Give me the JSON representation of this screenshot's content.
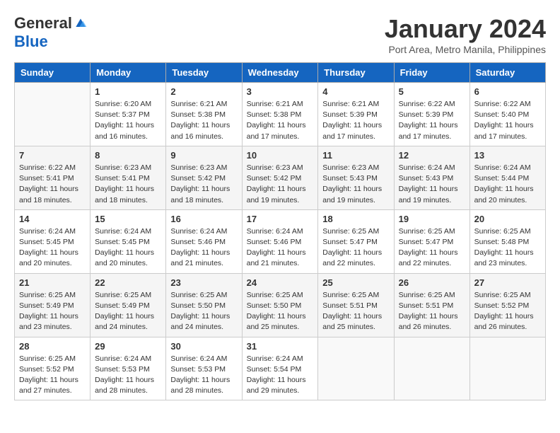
{
  "logo": {
    "general": "General",
    "blue": "Blue"
  },
  "title": "January 2024",
  "location": "Port Area, Metro Manila, Philippines",
  "days_of_week": [
    "Sunday",
    "Monday",
    "Tuesday",
    "Wednesday",
    "Thursday",
    "Friday",
    "Saturday"
  ],
  "weeks": [
    [
      {
        "day": "",
        "sunrise": "",
        "sunset": "",
        "daylight": ""
      },
      {
        "day": "1",
        "sunrise": "Sunrise: 6:20 AM",
        "sunset": "Sunset: 5:37 PM",
        "daylight": "Daylight: 11 hours and 16 minutes."
      },
      {
        "day": "2",
        "sunrise": "Sunrise: 6:21 AM",
        "sunset": "Sunset: 5:38 PM",
        "daylight": "Daylight: 11 hours and 16 minutes."
      },
      {
        "day": "3",
        "sunrise": "Sunrise: 6:21 AM",
        "sunset": "Sunset: 5:38 PM",
        "daylight": "Daylight: 11 hours and 17 minutes."
      },
      {
        "day": "4",
        "sunrise": "Sunrise: 6:21 AM",
        "sunset": "Sunset: 5:39 PM",
        "daylight": "Daylight: 11 hours and 17 minutes."
      },
      {
        "day": "5",
        "sunrise": "Sunrise: 6:22 AM",
        "sunset": "Sunset: 5:39 PM",
        "daylight": "Daylight: 11 hours and 17 minutes."
      },
      {
        "day": "6",
        "sunrise": "Sunrise: 6:22 AM",
        "sunset": "Sunset: 5:40 PM",
        "daylight": "Daylight: 11 hours and 17 minutes."
      }
    ],
    [
      {
        "day": "7",
        "sunrise": "Sunrise: 6:22 AM",
        "sunset": "Sunset: 5:41 PM",
        "daylight": "Daylight: 11 hours and 18 minutes."
      },
      {
        "day": "8",
        "sunrise": "Sunrise: 6:23 AM",
        "sunset": "Sunset: 5:41 PM",
        "daylight": "Daylight: 11 hours and 18 minutes."
      },
      {
        "day": "9",
        "sunrise": "Sunrise: 6:23 AM",
        "sunset": "Sunset: 5:42 PM",
        "daylight": "Daylight: 11 hours and 18 minutes."
      },
      {
        "day": "10",
        "sunrise": "Sunrise: 6:23 AM",
        "sunset": "Sunset: 5:42 PM",
        "daylight": "Daylight: 11 hours and 19 minutes."
      },
      {
        "day": "11",
        "sunrise": "Sunrise: 6:23 AM",
        "sunset": "Sunset: 5:43 PM",
        "daylight": "Daylight: 11 hours and 19 minutes."
      },
      {
        "day": "12",
        "sunrise": "Sunrise: 6:24 AM",
        "sunset": "Sunset: 5:43 PM",
        "daylight": "Daylight: 11 hours and 19 minutes."
      },
      {
        "day": "13",
        "sunrise": "Sunrise: 6:24 AM",
        "sunset": "Sunset: 5:44 PM",
        "daylight": "Daylight: 11 hours and 20 minutes."
      }
    ],
    [
      {
        "day": "14",
        "sunrise": "Sunrise: 6:24 AM",
        "sunset": "Sunset: 5:45 PM",
        "daylight": "Daylight: 11 hours and 20 minutes."
      },
      {
        "day": "15",
        "sunrise": "Sunrise: 6:24 AM",
        "sunset": "Sunset: 5:45 PM",
        "daylight": "Daylight: 11 hours and 20 minutes."
      },
      {
        "day": "16",
        "sunrise": "Sunrise: 6:24 AM",
        "sunset": "Sunset: 5:46 PM",
        "daylight": "Daylight: 11 hours and 21 minutes."
      },
      {
        "day": "17",
        "sunrise": "Sunrise: 6:24 AM",
        "sunset": "Sunset: 5:46 PM",
        "daylight": "Daylight: 11 hours and 21 minutes."
      },
      {
        "day": "18",
        "sunrise": "Sunrise: 6:25 AM",
        "sunset": "Sunset: 5:47 PM",
        "daylight": "Daylight: 11 hours and 22 minutes."
      },
      {
        "day": "19",
        "sunrise": "Sunrise: 6:25 AM",
        "sunset": "Sunset: 5:47 PM",
        "daylight": "Daylight: 11 hours and 22 minutes."
      },
      {
        "day": "20",
        "sunrise": "Sunrise: 6:25 AM",
        "sunset": "Sunset: 5:48 PM",
        "daylight": "Daylight: 11 hours and 23 minutes."
      }
    ],
    [
      {
        "day": "21",
        "sunrise": "Sunrise: 6:25 AM",
        "sunset": "Sunset: 5:49 PM",
        "daylight": "Daylight: 11 hours and 23 minutes."
      },
      {
        "day": "22",
        "sunrise": "Sunrise: 6:25 AM",
        "sunset": "Sunset: 5:49 PM",
        "daylight": "Daylight: 11 hours and 24 minutes."
      },
      {
        "day": "23",
        "sunrise": "Sunrise: 6:25 AM",
        "sunset": "Sunset: 5:50 PM",
        "daylight": "Daylight: 11 hours and 24 minutes."
      },
      {
        "day": "24",
        "sunrise": "Sunrise: 6:25 AM",
        "sunset": "Sunset: 5:50 PM",
        "daylight": "Daylight: 11 hours and 25 minutes."
      },
      {
        "day": "25",
        "sunrise": "Sunrise: 6:25 AM",
        "sunset": "Sunset: 5:51 PM",
        "daylight": "Daylight: 11 hours and 25 minutes."
      },
      {
        "day": "26",
        "sunrise": "Sunrise: 6:25 AM",
        "sunset": "Sunset: 5:51 PM",
        "daylight": "Daylight: 11 hours and 26 minutes."
      },
      {
        "day": "27",
        "sunrise": "Sunrise: 6:25 AM",
        "sunset": "Sunset: 5:52 PM",
        "daylight": "Daylight: 11 hours and 26 minutes."
      }
    ],
    [
      {
        "day": "28",
        "sunrise": "Sunrise: 6:25 AM",
        "sunset": "Sunset: 5:52 PM",
        "daylight": "Daylight: 11 hours and 27 minutes."
      },
      {
        "day": "29",
        "sunrise": "Sunrise: 6:24 AM",
        "sunset": "Sunset: 5:53 PM",
        "daylight": "Daylight: 11 hours and 28 minutes."
      },
      {
        "day": "30",
        "sunrise": "Sunrise: 6:24 AM",
        "sunset": "Sunset: 5:53 PM",
        "daylight": "Daylight: 11 hours and 28 minutes."
      },
      {
        "day": "31",
        "sunrise": "Sunrise: 6:24 AM",
        "sunset": "Sunset: 5:54 PM",
        "daylight": "Daylight: 11 hours and 29 minutes."
      },
      {
        "day": "",
        "sunrise": "",
        "sunset": "",
        "daylight": ""
      },
      {
        "day": "",
        "sunrise": "",
        "sunset": "",
        "daylight": ""
      },
      {
        "day": "",
        "sunrise": "",
        "sunset": "",
        "daylight": ""
      }
    ]
  ]
}
